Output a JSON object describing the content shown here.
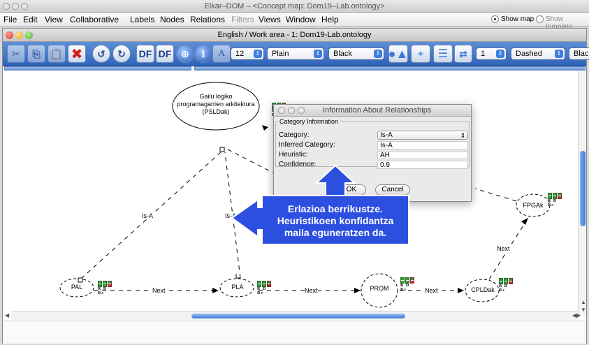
{
  "app": {
    "title": "Elkar–DOM – <Concept map: Dom19–Lab.ontology>"
  },
  "menubar": {
    "items": [
      "File",
      "Edit",
      "View",
      "Collaborative",
      "Labels",
      "Nodes",
      "Relations",
      "Filters",
      "Views",
      "Window",
      "Help"
    ],
    "disabled_item": "Filters",
    "show_map": "Show map",
    "show_template": "Show template",
    "show_map_selected": true
  },
  "work_area": {
    "title": "English / Work area - 1: Dom19-Lab.ontology"
  },
  "toolbar": {
    "font_size": "12",
    "font_style": "Plain",
    "font_color": "Black",
    "line_width": "1",
    "line_style": "Dashed",
    "line_color": "Black",
    "df_label": "DF",
    "a_label": "A",
    "icons": [
      "cut-icon",
      "copy-icon",
      "paste-icon",
      "delete-icon",
      "undo-icon",
      "redo-icon",
      "zoom-icon",
      "info-icon",
      "text-icon",
      "node-shapes-icon",
      "shape-picker-icon",
      "arrange-icon",
      "direction-icon"
    ]
  },
  "map": {
    "nodes": {
      "root": "Gailu logiko programagarrien arkitektura (PSLDak)",
      "pal": "PAL",
      "pla": "PLA",
      "prom": "PROM",
      "cpldak": "CPLDak",
      "fpgak": "FPGAk"
    },
    "relations": {
      "pal_root": "Is-A",
      "pla_root": "Is-A",
      "pal_pla": "Next",
      "pla_prom": "Next",
      "prom_cpldak": "Next",
      "cpldak_fpgak": "Next"
    },
    "badge_letters": "R D Rs",
    "badge_letters_prom": "R D Rs"
  },
  "dialog": {
    "title": "Information About Relationships",
    "group": "Category Information",
    "category_label": "Category:",
    "category_value": "Is-A",
    "inferred_label": "Inferred Category:",
    "inferred_value": "Is-A",
    "heuristic_label": "Heuristic:",
    "heuristic_value": "AH",
    "confidence_label": "Confidence:",
    "confidence_value": "0.9",
    "ok": "OK",
    "cancel": "Cancel"
  },
  "callout": {
    "text_line1": "Erlazioa berrikustze.",
    "text_line2": "Heuristikoen konfidantza",
    "text_line3": "maila eguneratzen da.",
    "color": "#2d4fe0"
  }
}
